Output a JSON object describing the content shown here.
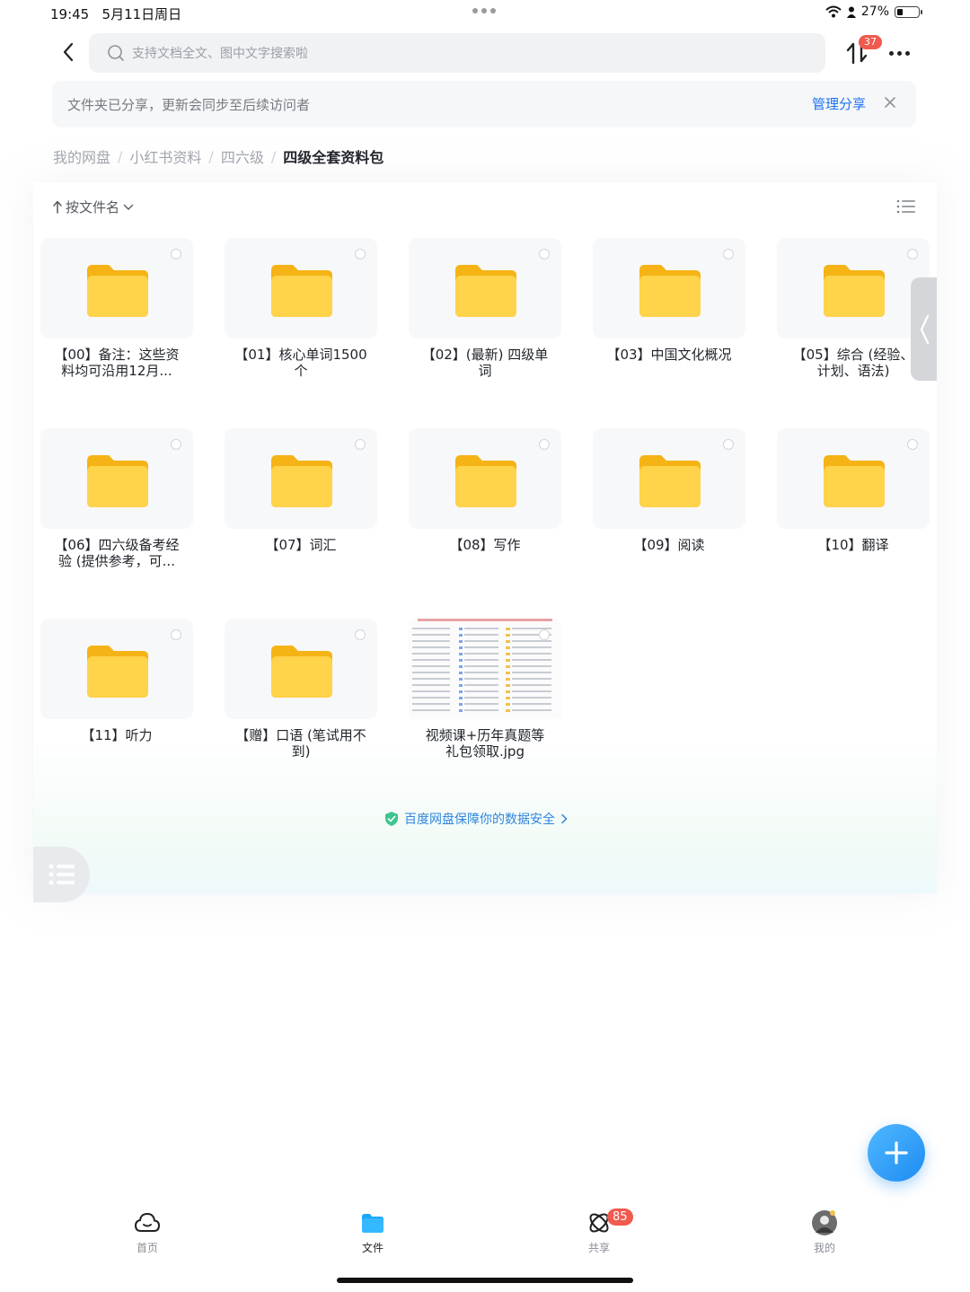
{
  "status_bar": {
    "time": "19:45",
    "date": "5月11日周日",
    "battery": "27%",
    "battery_level": 0.27
  },
  "search": {
    "placeholder": "支持文档全文、图中文字搜索啦"
  },
  "transfer_badge": "37",
  "share_banner": {
    "message": "文件夹已分享，更新会同步至后续访问者",
    "manage_label": "管理分享"
  },
  "breadcrumb": [
    {
      "label": "我的网盘"
    },
    {
      "label": "小红书资料"
    },
    {
      "label": "四六级"
    },
    {
      "label": "四级全套资料包"
    }
  ],
  "sort_label": "按文件名",
  "files": [
    {
      "type": "folder",
      "line1": "【00】备注：这些资",
      "line2": "料均可沿用12月..."
    },
    {
      "type": "folder",
      "line1": "【01】核心单词1500",
      "line2": "个"
    },
    {
      "type": "folder",
      "line1": "【02】(最新) 四级单",
      "line2": "词"
    },
    {
      "type": "folder",
      "line1": "【03】中国文化概况",
      "line2": ""
    },
    {
      "type": "folder",
      "line1": "【05】综合 (经验、",
      "line2": "计划、语法)"
    },
    {
      "type": "folder",
      "line1": "【06】四六级备考经",
      "line2": "验 (提供参考，可..."
    },
    {
      "type": "folder",
      "line1": "【07】词汇",
      "line2": ""
    },
    {
      "type": "folder",
      "line1": "【08】写作",
      "line2": ""
    },
    {
      "type": "folder",
      "line1": "【09】阅读",
      "line2": ""
    },
    {
      "type": "folder",
      "line1": "【10】翻译",
      "line2": ""
    },
    {
      "type": "folder",
      "line1": "【11】听力",
      "line2": ""
    },
    {
      "type": "folder",
      "line1": "【赠】口语 (笔试用不",
      "line2": "到)"
    },
    {
      "type": "image",
      "line1": "视频课+历年真题等",
      "line2": "礼包领取.jpg"
    }
  ],
  "safety_notice": "百度网盘保障你的数据安全",
  "tabs": [
    {
      "label": "首页",
      "icon": "cloud-icon"
    },
    {
      "label": "文件",
      "icon": "folder-icon",
      "active": true
    },
    {
      "label": "共享",
      "icon": "share-icon",
      "badge": "85"
    },
    {
      "label": "我的",
      "icon": "avatar"
    }
  ],
  "colors": {
    "accent": "#1d72f3",
    "folder": "#ffc93c",
    "badge": "#f05a4f",
    "fab": "#1e8bf2"
  }
}
